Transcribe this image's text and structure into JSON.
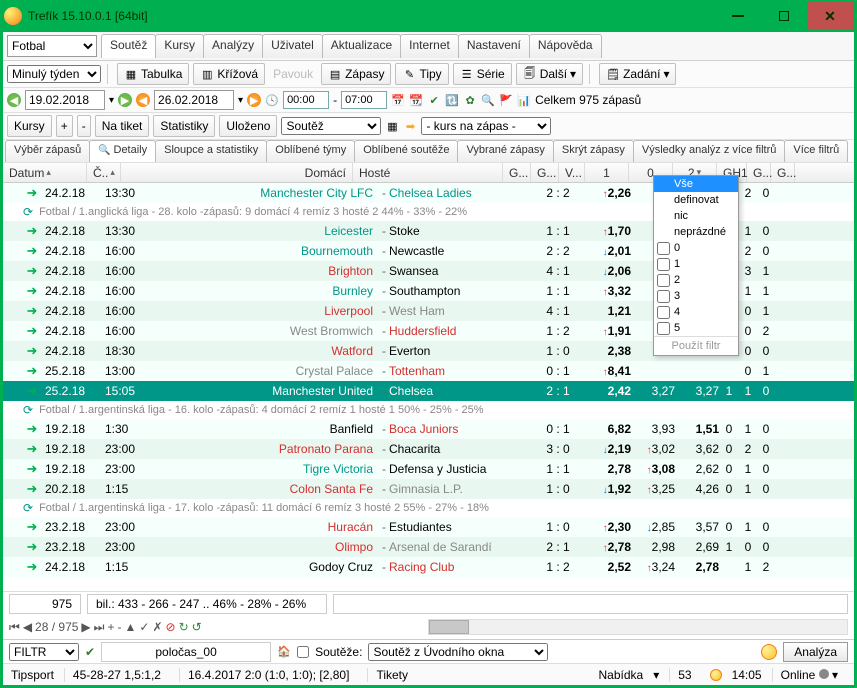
{
  "title": "Trefík 15.10.0.1 [64bit]",
  "top_select": "Fotbal",
  "period_select": "Minulý týden",
  "main_tabs": [
    "Soutěž",
    "Kursy",
    "Analýzy",
    "Uživatel",
    "Aktualizace",
    "Internet",
    "Nastavení",
    "Nápověda"
  ],
  "main_tab_active": 0,
  "toolbar1": {
    "tabulka": "Tabulka",
    "krizova": "Křížová",
    "pavouk": "Pavouk",
    "zapasy": "Zápasy",
    "tipy": "Tipy",
    "serie": "Série",
    "dalsi": "Další",
    "zadani": "Zadání"
  },
  "date_from": "19.02.2018",
  "date_to": "26.02.2018",
  "time_from": "00:00",
  "time_to": "07:00",
  "total_matches": "Celkem 975 zápasů",
  "toolbar3": {
    "kursy": "Kursy",
    "natiket": "Na tiket",
    "statistiky": "Statistiky",
    "ulozeno": "Uloženo",
    "soutez_sel": "Soutěž",
    "kurs_sel": "- kurs na zápas -"
  },
  "filter_tabs": [
    "Výběr zápasů",
    "Detaily",
    "Sloupce a statistiky",
    "Oblíbené týmy",
    "Oblíbené soutěže",
    "Vybrané zápasy",
    "Skrýt zápasy",
    "Výsledky analýz z více filtrů",
    "Více filtrů"
  ],
  "filter_tab_active": 1,
  "columns": {
    "datum": "Datum",
    "domaci": "Domácí",
    "hoste": "Hosté",
    "g": "G...",
    "g2": "G...",
    "v": "V...",
    "one": "1",
    "zero": "0",
    "two": "2",
    "gh1": "GH1",
    "gcol": "G...",
    "gcol2": "G..."
  },
  "groups": [
    {
      "id": "top",
      "rows": [
        {
          "date": "24.2.18",
          "time": "13:30",
          "home": "Manchester City LFC",
          "homeColor": "green",
          "away": "Chelsea Ladies",
          "awayColor": "green",
          "score": "2 : 2",
          "o1": "2,26",
          "arrow1": "up",
          "o2": "",
          "o3": "",
          "gh": "2",
          "g1": "2",
          "g2": "0"
        }
      ]
    },
    {
      "header": "Fotbal / 1.anglická liga - 28. kolo -zápasů: 9  domácí 4  remíz 3  hosté 2     44% - 33% - 22%",
      "rows": [
        {
          "date": "24.2.18",
          "time": "13:30",
          "home": "Leicester",
          "homeColor": "green",
          "away": "Stoke",
          "awayColor": "",
          "score": "1 : 1",
          "o1": "1,70",
          "arrow1": "up",
          "o2": "",
          "o3": "",
          "gh": "",
          "g1": "1",
          "g2": "0"
        },
        {
          "date": "24.2.18",
          "time": "16:00",
          "home": "Bournemouth",
          "homeColor": "green",
          "away": "Newcastle",
          "awayColor": "",
          "score": "2 : 2",
          "o1": "2,01",
          "arrow1": "down",
          "o2": "",
          "o3": "",
          "gh": "",
          "g1": "2",
          "g2": "0"
        },
        {
          "date": "24.2.18",
          "time": "16:00",
          "home": "Brighton",
          "homeColor": "red",
          "away": "Swansea",
          "awayColor": "",
          "score": "4 : 1",
          "o1": "2,06",
          "arrow1": "down",
          "o2": "",
          "o3": "",
          "gh": "",
          "g1": "3",
          "g2": "1"
        },
        {
          "date": "24.2.18",
          "time": "16:00",
          "home": "Burnley",
          "homeColor": "green",
          "away": "Southampton",
          "awayColor": "",
          "score": "1 : 1",
          "o1": "3,32",
          "arrow1": "up",
          "o2": "",
          "o3": "",
          "gh": "",
          "g1": "1",
          "g2": "1"
        },
        {
          "date": "24.2.18",
          "time": "16:00",
          "home": "Liverpool",
          "homeColor": "red",
          "away": "West Ham",
          "awayColor": "gray",
          "score": "4 : 1",
          "o1": "1,21",
          "o2": "",
          "o3": "",
          "gh": "",
          "g1": "0",
          "g2": "1"
        },
        {
          "date": "24.2.18",
          "time": "16:00",
          "home": "West Bromwich",
          "homeColor": "gray",
          "away": "Huddersfield",
          "awayColor": "red",
          "score": "1 : 2",
          "o1": "1,91",
          "arrow1": "up",
          "o2": "",
          "o3": "",
          "gh": "",
          "g1": "0",
          "g2": "2"
        },
        {
          "date": "24.2.18",
          "time": "18:30",
          "home": "Watford",
          "homeColor": "red",
          "away": "Everton",
          "awayColor": "",
          "score": "1 : 0",
          "o1": "2,38",
          "o2": "",
          "o3": "",
          "gh": "",
          "g1": "0",
          "g2": "0"
        },
        {
          "date": "25.2.18",
          "time": "13:00",
          "home": "Crystal Palace",
          "homeColor": "gray",
          "away": "Tottenham",
          "awayColor": "red",
          "score": "0 : 1",
          "o1": "8,41",
          "arrow1": "up",
          "o2": "",
          "o3": "",
          "gh": "",
          "g1": "0",
          "g2": "1"
        },
        {
          "date": "25.2.18",
          "time": "15:05",
          "home": "Manchester United",
          "homeColor": "",
          "away": "Chelsea",
          "awayColor": "",
          "score": "2 : 1",
          "o1": "2,42",
          "o2": "3,27",
          "o3": "3,27",
          "gh": "1",
          "g1": "1",
          "g2": "0",
          "selected": true
        }
      ]
    },
    {
      "header": "Fotbal / 1.argentinská liga - 16. kolo -zápasů: 4  domácí 2  remíz 1  hosté 1     50% - 25% - 25%",
      "rows": [
        {
          "date": "19.2.18",
          "time": "1:30",
          "home": "Banfield",
          "homeColor": "",
          "away": "Boca Juniors",
          "awayColor": "red",
          "score": "0 : 1",
          "o1": "6,82",
          "o2": "3,93",
          "o3": "1,51",
          "bold3": true,
          "gh": "0",
          "g1": "1",
          "g2": "0"
        },
        {
          "date": "19.2.18",
          "time": "23:00",
          "home": "Patronato Parana",
          "homeColor": "red",
          "away": "Chacarita",
          "awayColor": "",
          "score": "3 : 0",
          "o1": "2,19",
          "arrow1": "down",
          "o2": "3,02",
          "arrow2": "up",
          "o3": "3,62",
          "gh": "0",
          "g1": "2",
          "g2": "0"
        },
        {
          "date": "19.2.18",
          "time": "23:00",
          "home": "Tigre Victoria",
          "homeColor": "green",
          "away": "Defensa y Justicia",
          "awayColor": "",
          "score": "1 : 1",
          "o1": "2,78",
          "o2": "3,08",
          "bold2": true,
          "arrow2": "up",
          "o3": "2,62",
          "gh": "0",
          "g1": "1",
          "g2": "0"
        },
        {
          "date": "20.2.18",
          "time": "1:15",
          "home": "Colon Santa Fe",
          "homeColor": "red",
          "away": "Gimnasia L.P.",
          "awayColor": "gray",
          "score": "1 : 0",
          "o1": "1,92",
          "arrow1": "down",
          "o2": "3,25",
          "arrow2": "up",
          "o3": "4,26",
          "gh": "0",
          "g1": "1",
          "g2": "0"
        }
      ]
    },
    {
      "header": "Fotbal / 1.argentinská liga - 17. kolo -zápasů: 11  domácí 6  remíz 3  hosté 2     55% - 27% - 18%",
      "rows": [
        {
          "date": "23.2.18",
          "time": "23:00",
          "home": "Huracán",
          "homeColor": "red",
          "away": "Estudiantes",
          "awayColor": "",
          "score": "1 : 0",
          "o1": "2,30",
          "arrow1": "up",
          "o2": "2,85",
          "arrow2": "down",
          "o3": "3,57",
          "gh": "0",
          "g1": "1",
          "g2": "0"
        },
        {
          "date": "23.2.18",
          "time": "23:00",
          "home": "Olimpo",
          "homeColor": "red",
          "away": "Arsenal de Sarandí",
          "awayColor": "gray",
          "score": "2 : 1",
          "o1": "2,78",
          "arrow1": "up",
          "o2": "2,98",
          "o3": "2,69",
          "gh": "1",
          "g1": "0",
          "g2": "0"
        },
        {
          "date": "24.2.18",
          "time": "1:15",
          "home": "Godoy Cruz",
          "homeColor": "",
          "away": "Racing Club",
          "awayColor": "red",
          "score": "1 : 2",
          "o1": "2,52",
          "o2": "3,24",
          "arrow2": "up",
          "o3": "2,78",
          "bold3": true,
          "gh": "",
          "g1": "1",
          "g2": "2"
        }
      ]
    }
  ],
  "dropdown": {
    "items_top": [
      "Vše",
      "definovat",
      "nic",
      "neprázdné"
    ],
    "items_chk": [
      "0",
      "1",
      "2",
      "3",
      "4",
      "5"
    ],
    "apply": "Použít filtr",
    "selected": 0
  },
  "footer_left_count": "975",
  "footer_bilance": "bil.: 433 - 266 - 247 .. 46% - 28% - 26%",
  "pager": "28 / 975",
  "filtr_label": "FILTR",
  "polocas": "poločas_00",
  "souteze_label": "Soutěže:",
  "souteze_sel": "Soutěž z Úvodního okna",
  "analyza_btn": "Analýza",
  "status": {
    "broker": "Tipsport",
    "record": "45-28-27  1,5:1,2",
    "match": "16.4.2017 2:0 (1:0, 1:0); [2,80]",
    "tikety": "Tikety",
    "nabidka": "Nabídka",
    "num": "53",
    "time": "14:05",
    "online": "Online"
  }
}
